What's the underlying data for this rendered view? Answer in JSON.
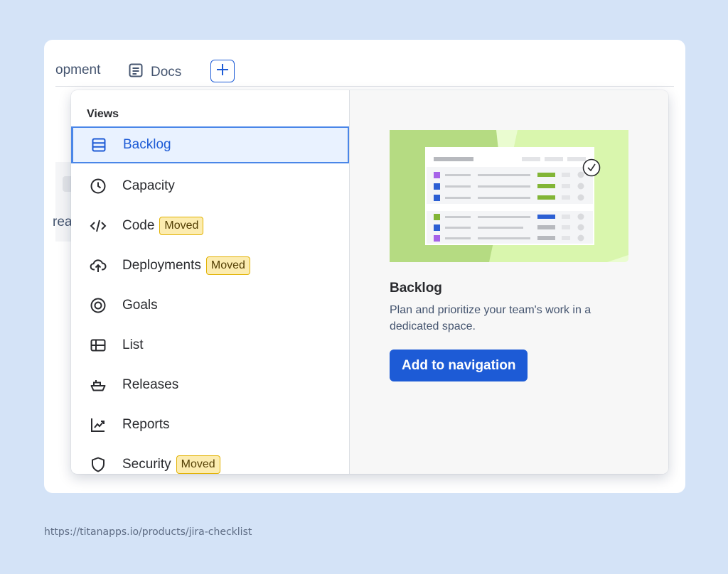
{
  "tabs": {
    "partial_label": "opment",
    "docs_label": "Docs",
    "add_icon": "plus-icon"
  },
  "background": {
    "partial_text": "rea"
  },
  "menu": {
    "heading": "Views",
    "items": [
      {
        "label": "Backlog",
        "icon": "backlog-icon",
        "selected": true,
        "badge": ""
      },
      {
        "label": "Capacity",
        "icon": "clock-icon",
        "badge": ""
      },
      {
        "label": "Code",
        "icon": "code-icon",
        "badge": "Moved"
      },
      {
        "label": "Deployments",
        "icon": "cloud-upload-icon",
        "badge": "Moved"
      },
      {
        "label": "Goals",
        "icon": "target-icon",
        "badge": ""
      },
      {
        "label": "List",
        "icon": "table-icon",
        "badge": ""
      },
      {
        "label": "Releases",
        "icon": "ship-icon",
        "badge": ""
      },
      {
        "label": "Reports",
        "icon": "chart-icon",
        "badge": ""
      },
      {
        "label": "Security",
        "icon": "shield-icon",
        "badge": "Moved"
      }
    ]
  },
  "detail": {
    "title": "Backlog",
    "description": "Plan and prioritize your team's work in a dedicated space.",
    "button_label": "Add to navigation"
  },
  "footer": {
    "url": "https://titanapps.io/products/jira-checklist"
  },
  "colors": {
    "page_bg": "#d4e3f7",
    "accent": "#1d5bd6",
    "badge_bg": "#fcecb0",
    "selected_bg": "#e9f2ff"
  }
}
